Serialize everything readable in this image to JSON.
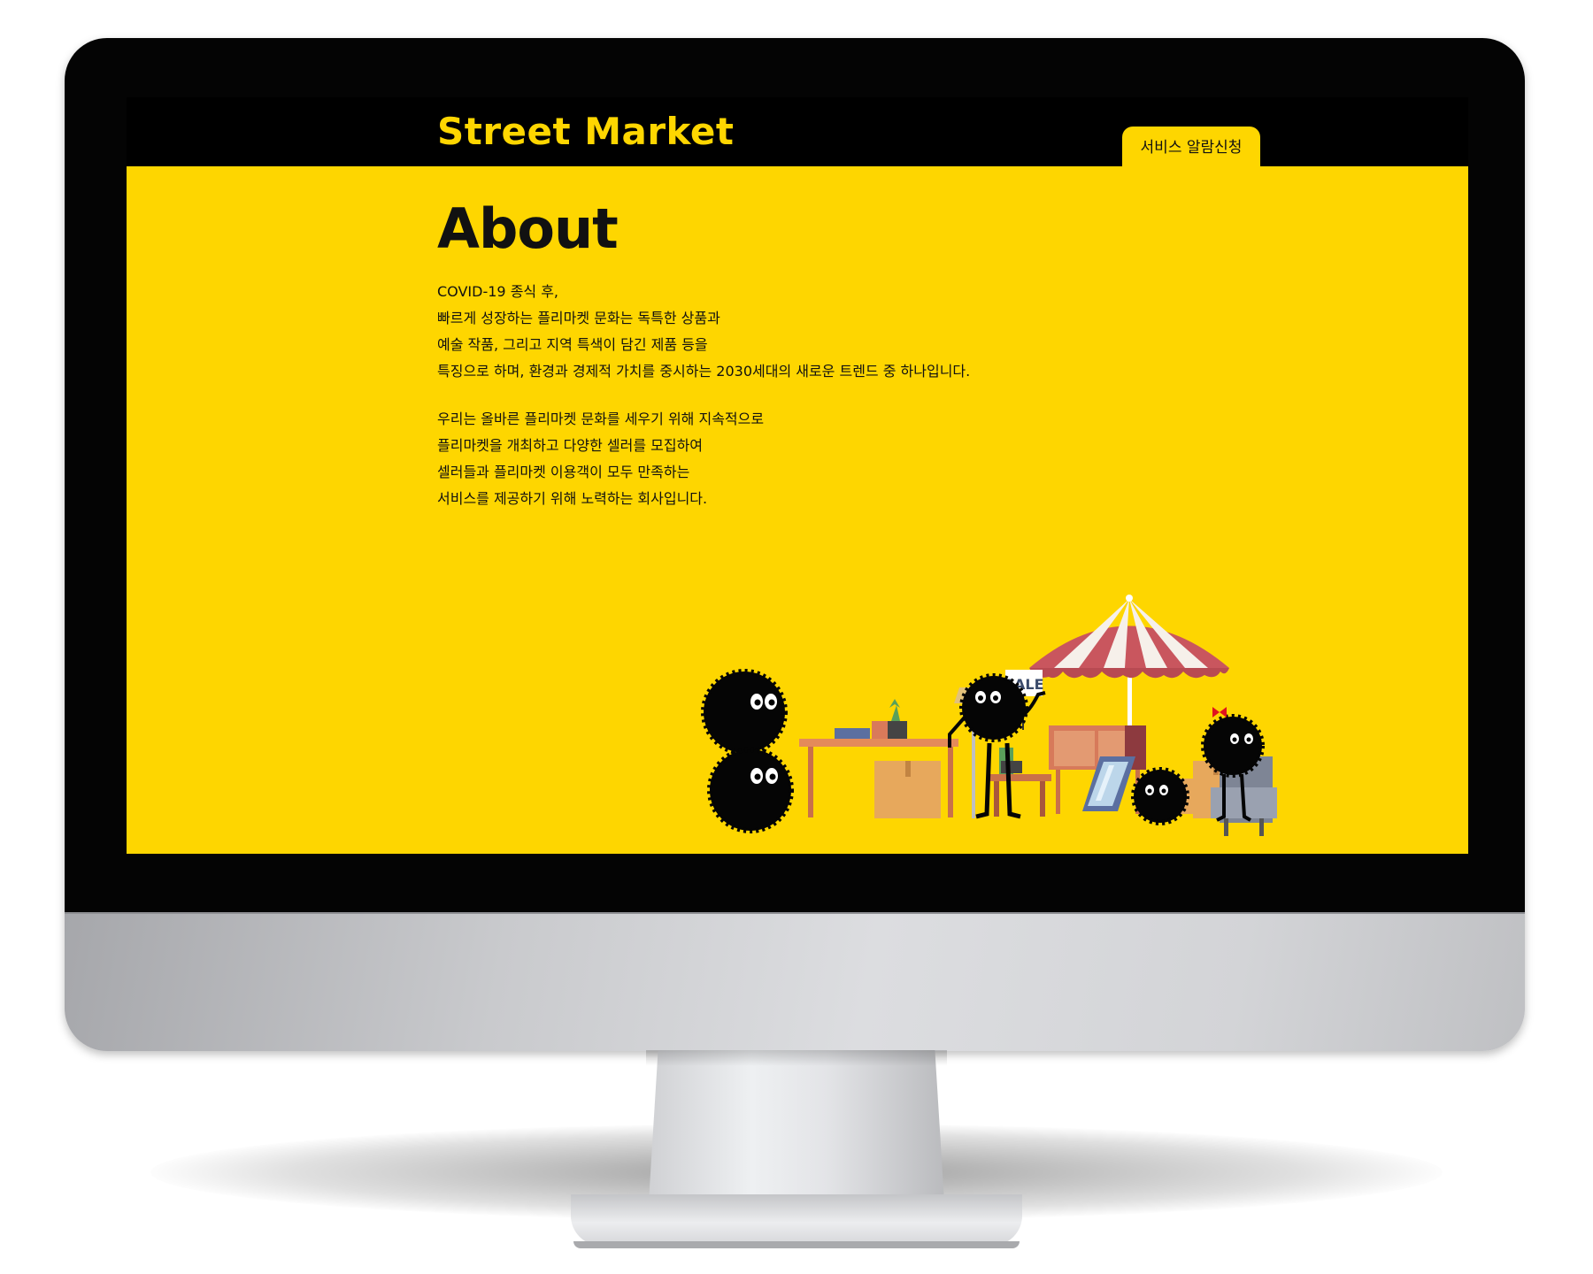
{
  "header": {
    "logo": "Street Market",
    "nav_button": "서비스 알람신청"
  },
  "about": {
    "title": "About",
    "paragraph1": [
      "COVID-19 종식 후,",
      "빠르게 성장하는 플리마켓 문화는 독특한 상품과",
      "예술 작품, 그리고 지역 특색이 담긴 제품 등을",
      "특징으로 하며, 환경과 경제적 가치를 중시하는 2030세대의 새로운 트렌드 중 하나입니다."
    ],
    "paragraph2": [
      "우리는 올바른 플리마켓 문화를 세우기 위해 지속적으로",
      "플리마켓을 개최하고 다양한 셀러를 모집하여",
      "셀러들과 플리마켓 이용객이 모두 만족하는",
      "서비스를 제공하기 위해 노력하는 회사입니다."
    ]
  },
  "illustration": {
    "sign_text": "SALE"
  },
  "colors": {
    "accent": "#fed600",
    "nav_background": "#000000",
    "umbrella_red": "#c9565e"
  }
}
